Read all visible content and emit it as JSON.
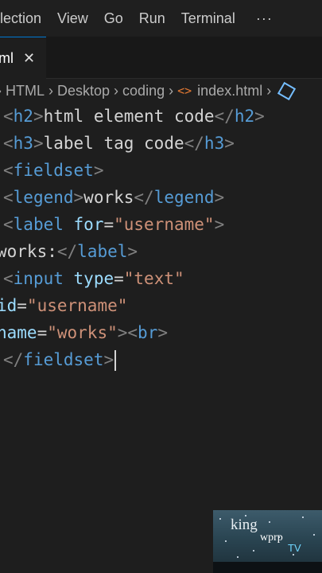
{
  "menu": {
    "items": [
      "election",
      "View",
      "Go",
      "Run",
      "Terminal"
    ],
    "more": "···"
  },
  "tab": {
    "label": "ml",
    "close": "✕"
  },
  "breadcrumb": {
    "parts": [
      "HTML",
      "Desktop",
      "coding",
      "index.html"
    ],
    "html_icon": "<>",
    "icons": [
      "chevron-right-icon",
      "html-file-icon",
      "cube-symbol-icon"
    ]
  },
  "code": {
    "line1": {
      "open_tag": "h2",
      "text": "html element code",
      "close_tag": "h2"
    },
    "line2": {
      "open_tag": "h3",
      "text": "label tag code",
      "close_tag": "h3"
    },
    "line3": {
      "open_tag": "fieldset"
    },
    "line4": {
      "open_tag": "legend",
      "text": "works",
      "close_tag": "legend"
    },
    "line5": {
      "tag": "label",
      "attr": "for",
      "value": "\"username\""
    },
    "line6": {
      "text": "works:",
      "close_tag": "label"
    },
    "line7": {
      "tag": "input",
      "attr": "type",
      "value": "\"text\""
    },
    "line8": {
      "attr": "id",
      "value": "\"username\""
    },
    "line9": {
      "attr": "name",
      "value": "\"works\"",
      "tag": "br"
    },
    "line10": {
      "close_tag": "fieldset"
    }
  },
  "watermark": {
    "line1": "king",
    "line2": "wprp",
    "line3": "TV"
  },
  "colors": {
    "editor_bg": "#1e1e1e",
    "tag": "#569cd6",
    "attribute": "#9cdcfe",
    "string": "#ce9178",
    "punctuation": "#808080",
    "text": "#d4d4d4",
    "accent": "#0078d4"
  }
}
